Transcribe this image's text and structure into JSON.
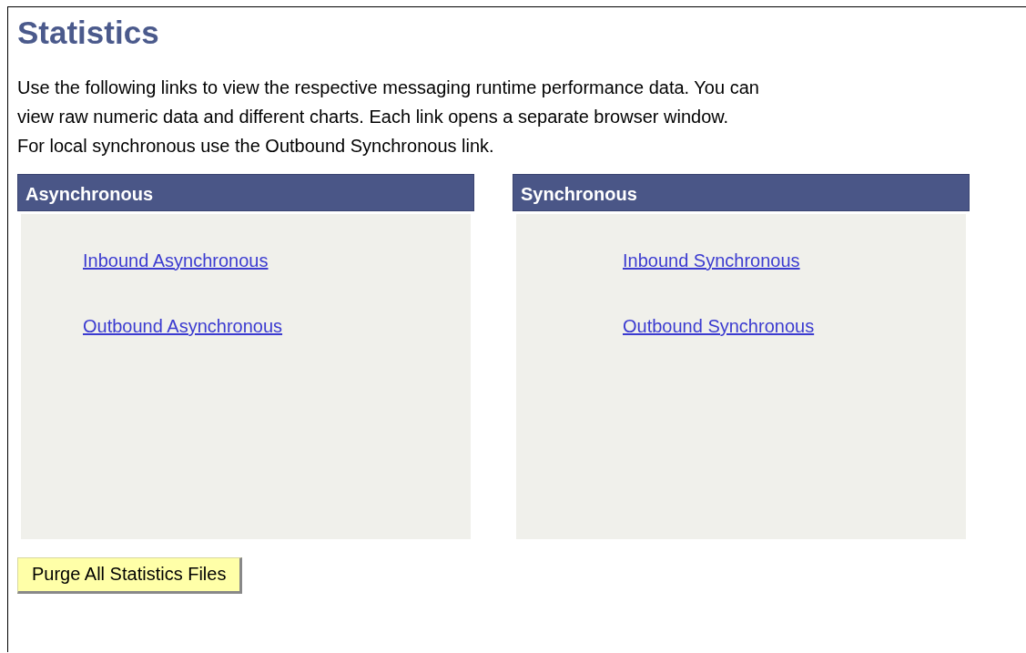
{
  "title": "Statistics",
  "description": "Use the following links to view the respective messaging runtime performance data. You can view raw numeric data and different charts. Each link opens a separate browser window. For local synchronous use the Outbound Synchronous link.",
  "panels": [
    {
      "header": "Asynchronous",
      "links": [
        "Inbound Asynchronous",
        "Outbound Asynchronous"
      ]
    },
    {
      "header": "Synchronous",
      "links": [
        "Inbound Synchronous",
        "Outbound Synchronous"
      ]
    }
  ],
  "button": "Purge All Statistics Files"
}
